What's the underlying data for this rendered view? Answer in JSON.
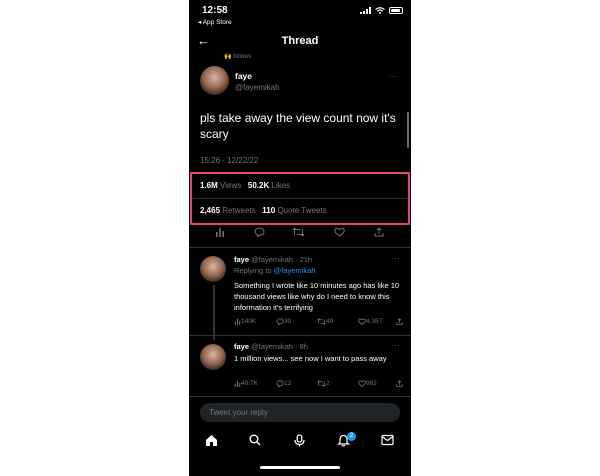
{
  "status_bar": {
    "time": "12:58",
    "back_app": "◂ App Store"
  },
  "nav": {
    "back": "←",
    "title": "Thread"
  },
  "context": {
    "follows": "🙌 follows"
  },
  "main_tweet": {
    "name": "faye",
    "handle": "@fayemikah",
    "more": "···",
    "text": "pls take away the view count now it's scary",
    "datetime": "15:26 · 12/22/22"
  },
  "stats": {
    "views_count": "1.6M",
    "views_label": "Views",
    "likes_count": "50.2K",
    "likes_label": "Likes",
    "retweets_count": "2,465",
    "retweets_label": "Retweets",
    "quotes_count": "110",
    "quotes_label": "Quote Tweets"
  },
  "highlight_color": "#e0457b",
  "replies": [
    {
      "name": "faye",
      "handle_time": "@fayemikah · 21h",
      "replying_prefix": "Replying to",
      "replying_to": "@fayemikah",
      "text": "Something I wrote like 10 minutes ago has like 10 thousand views like why do I need to know this information it's terrifying",
      "views": "140K",
      "replies": "30",
      "retweets": "49",
      "likes": "4,387"
    },
    {
      "name": "faye",
      "handle_time": "@fayemikah · 8h",
      "text": "1 million views... see now I want to pass away",
      "views": "40.7K",
      "replies": "12",
      "retweets": "2",
      "likes": "982"
    }
  ],
  "compose": {
    "placeholder": "Tweet your reply"
  },
  "tabbar": {
    "notification_badge": "2"
  },
  "colors": {
    "background": "#000000",
    "accent": "#1d9bf0",
    "muted": "#71767b"
  }
}
